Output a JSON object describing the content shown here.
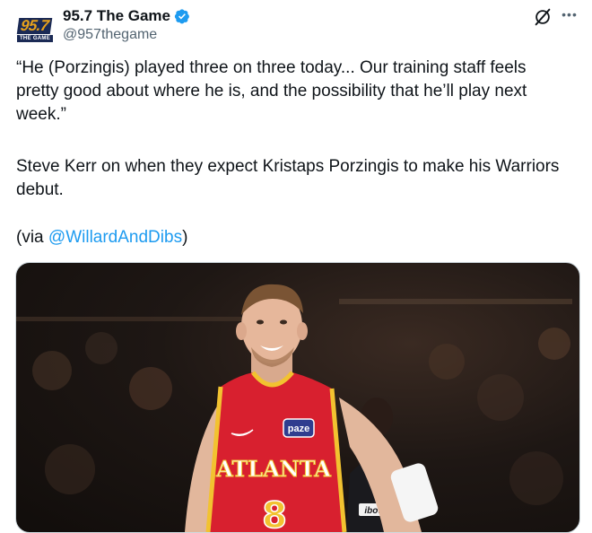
{
  "account": {
    "avatar_number": "95.7",
    "avatar_subtext": "THE GAME",
    "display_name": "95.7 The Game",
    "handle": "@957thegame",
    "verified_icon": "verified-badge-icon"
  },
  "header_icons": {
    "grok": "grok-icon",
    "more": "more-options-icon",
    "more_glyph": "•••"
  },
  "tweet": {
    "paragraph1": "“He (Porzingis) played three on three today... Our training staff feels pretty good about where he is, and the possibility that he’ll play next week.”",
    "paragraph2": "Steve Kerr on when they expect Kristaps Porzingis to make his Warriors debut.",
    "via_prefix": "(via ",
    "mention": "@WillardAndDibs",
    "via_suffix": ")"
  },
  "media": {
    "jersey_team": "ATLANTA",
    "jersey_number": "8",
    "jersey_patch": "paze",
    "background_sponsor": "ibotta",
    "colors": {
      "jersey_red": "#d8202f",
      "jersey_gold": "#f2c230",
      "patch_blue": "#2f3d8f",
      "background": "#1e1714"
    }
  }
}
